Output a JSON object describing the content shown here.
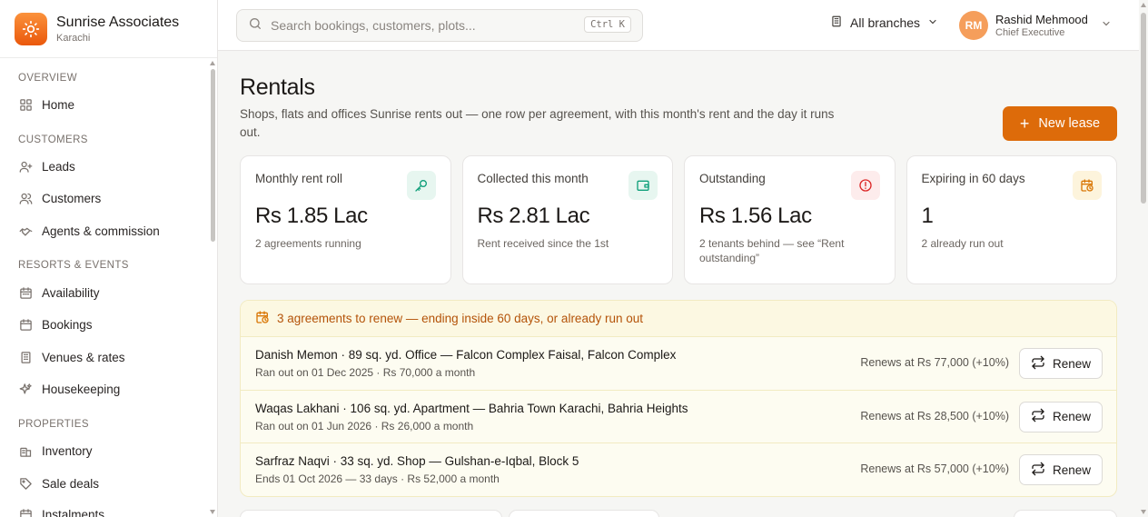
{
  "brand": {
    "name": "Sunrise Associates",
    "city": "Karachi"
  },
  "sidebar": {
    "sections": [
      {
        "label": "OVERVIEW",
        "items": [
          {
            "label": "Home",
            "icon": "grid-icon"
          }
        ]
      },
      {
        "label": "CUSTOMERS",
        "items": [
          {
            "label": "Leads",
            "icon": "user-plus-icon"
          },
          {
            "label": "Customers",
            "icon": "users-icon"
          },
          {
            "label": "Agents & commission",
            "icon": "handshake-icon"
          }
        ]
      },
      {
        "label": "RESORTS & EVENTS",
        "items": [
          {
            "label": "Availability",
            "icon": "calendar-icon"
          },
          {
            "label": "Bookings",
            "icon": "calendar-check-icon"
          },
          {
            "label": "Venues & rates",
            "icon": "building-icon"
          },
          {
            "label": "Housekeeping",
            "icon": "sparkles-icon"
          }
        ]
      },
      {
        "label": "PROPERTIES",
        "items": [
          {
            "label": "Inventory",
            "icon": "buildings-icon"
          },
          {
            "label": "Sale deals",
            "icon": "tag-icon"
          },
          {
            "label": "Instalments",
            "icon": "calendar-money-icon"
          }
        ]
      }
    ]
  },
  "topbar": {
    "search_placeholder": "Search bookings, customers, plots...",
    "shortcut": "Ctrl K",
    "branches": "All branches",
    "user": {
      "initials": "RM",
      "name": "Rashid Mehmood",
      "role": "Chief Executive"
    }
  },
  "page": {
    "title": "Rentals",
    "description": "Shops, flats and offices Sunrise rents out — one row per agreement, with this month's rent and the day it runs out.",
    "new_lease": "New lease"
  },
  "kpis": [
    {
      "label": "Monthly rent roll",
      "value": "Rs 1.85 Lac",
      "sub": "2 agreements running",
      "icon": "key-icon",
      "color": "#0f9f7a",
      "bg": "#e7f6f0"
    },
    {
      "label": "Collected this month",
      "value": "Rs 2.81 Lac",
      "sub": "Rent received since the 1st",
      "icon": "wallet-icon",
      "color": "#0f9f7a",
      "bg": "#e7f6f0"
    },
    {
      "label": "Outstanding",
      "value": "Rs 1.56 Lac",
      "sub": "2 tenants behind — see “Rent outstanding”",
      "icon": "alert-circle-icon",
      "color": "#dc2626",
      "bg": "#fdecec"
    },
    {
      "label": "Expiring in 60 days",
      "value": "1",
      "sub": "2 already run out",
      "icon": "calendar-clock-icon",
      "color": "#d97706",
      "bg": "#fdf4dc"
    }
  ],
  "renewals": {
    "heading": "3 agreements to renew — ending inside 60 days, or already run out",
    "button_label": "Renew",
    "rows": [
      {
        "title": "Danish Memon · 89 sq. yd. Office — Falcon Complex Faisal, Falcon Complex",
        "sub": "Ran out on 01 Dec 2025 · Rs 70,000 a month",
        "price": "Renews at Rs 77,000 (+10%)"
      },
      {
        "title": "Waqas Lakhani · 106 sq. yd. Apartment — Bahria Town Karachi, Bahria Heights",
        "sub": "Ran out on 01 Jun 2026 · Rs 26,000 a month",
        "price": "Renews at Rs 28,500 (+10%)"
      },
      {
        "title": "Sarfraz Naqvi · 33 sq. yd. Shop — Gulshan-e-Iqbal, Block 5",
        "sub": "Ends 01 Oct 2026 — 33 days · Rs 52,000 a month",
        "price": "Renews at Rs 57,000 (+10%)"
      }
    ]
  },
  "colors": {
    "accent": "#dd6b0a",
    "warn_text": "#b45309"
  }
}
